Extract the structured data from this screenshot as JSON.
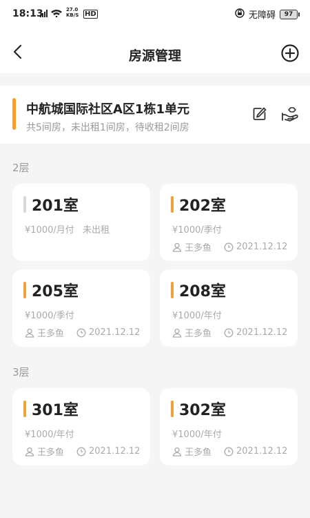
{
  "status_bar": {
    "time": "18:13",
    "net_speed_value": "27.0",
    "net_speed_unit": "KB/S",
    "hd": "HD",
    "accessibility": "无障碍",
    "battery": "97"
  },
  "nav": {
    "title": "房源管理",
    "back_icon": "chevron-left-icon",
    "add_icon": "plus-circle-icon"
  },
  "building": {
    "name": "中航城国际社区A区1栋1单元",
    "summary": "共5间房，未出租1间房，待收租2间房",
    "edit_icon": "edit-icon",
    "collect_icon": "hand-coin-icon"
  },
  "floors": [
    {
      "label": "2层",
      "rooms": [
        {
          "room": "201室",
          "rent": "¥1000/月付",
          "status": "未出租",
          "tenant": "",
          "date": ""
        },
        {
          "room": "202室",
          "rent": "¥1000/季付",
          "status": "",
          "tenant": "王多鱼",
          "date": "2021.12.12"
        },
        {
          "room": "205室",
          "rent": "¥1000/季付",
          "status": "",
          "tenant": "王多鱼",
          "date": "2021.12.12"
        },
        {
          "room": "208室",
          "rent": "¥1000/年付",
          "status": "",
          "tenant": "王多鱼",
          "date": "2021.12.12"
        }
      ]
    },
    {
      "label": "3层",
      "rooms": [
        {
          "room": "301室",
          "rent": "¥1000/年付",
          "status": "",
          "tenant": "王多鱼",
          "date": "2021.12.12"
        },
        {
          "room": "302室",
          "rent": "¥1000/年付",
          "status": "",
          "tenant": "王多鱼",
          "date": "2021.12.12"
        }
      ]
    }
  ],
  "colors": {
    "accent": "#F0A23A",
    "vacant_bar": "#D8D8D8",
    "muted_text": "#AAAAAA",
    "background": "#F5F5F5"
  }
}
